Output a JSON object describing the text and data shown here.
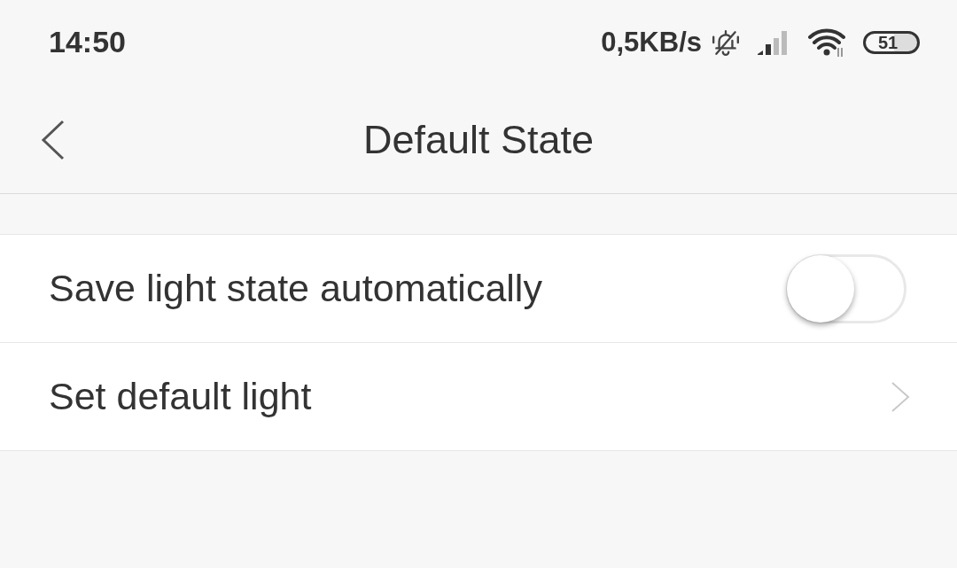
{
  "status_bar": {
    "time": "14:50",
    "network_speed": "0,5KB/s",
    "battery_percent": "51"
  },
  "header": {
    "title": "Default State"
  },
  "settings": [
    {
      "kind": "toggle",
      "label": "Save light state automatically",
      "on": false
    },
    {
      "kind": "link",
      "label": "Set default light"
    }
  ]
}
